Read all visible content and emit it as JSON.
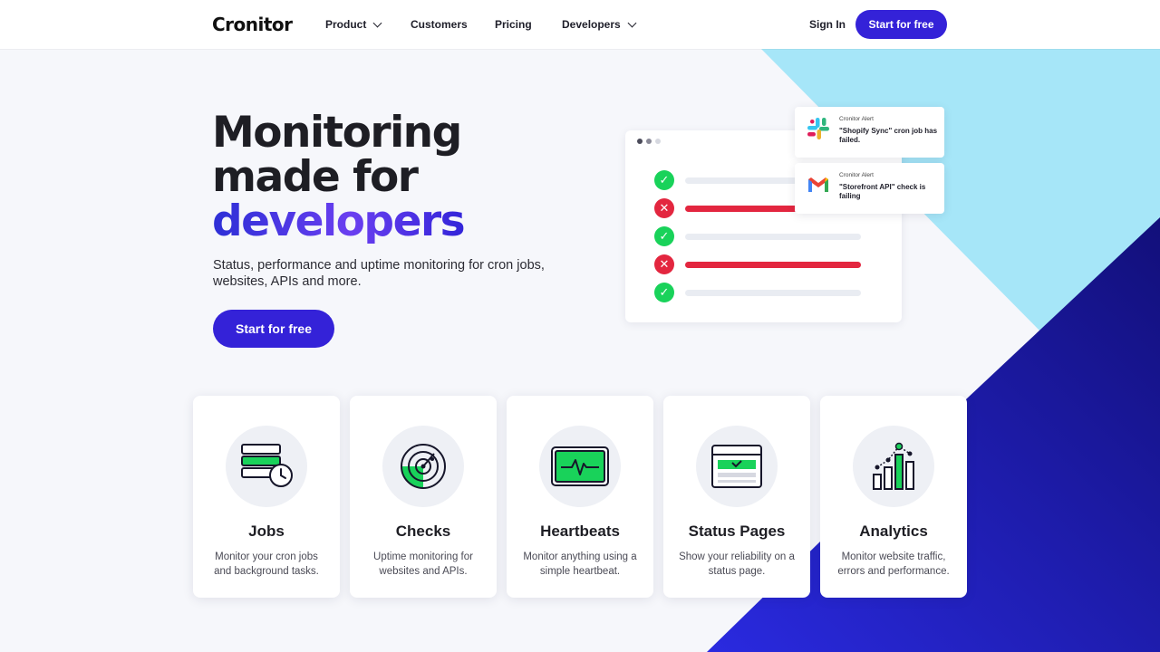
{
  "colors": {
    "brand": "#3422d8",
    "ok": "#19d25a",
    "fail": "#e3263f",
    "light_blue": "#a6e6f8",
    "dark_blue": "#1b1ca6"
  },
  "nav": {
    "logo": "Cronitor",
    "items": [
      {
        "label": "Product",
        "has_dropdown": true
      },
      {
        "label": "Customers",
        "has_dropdown": false
      },
      {
        "label": "Pricing",
        "has_dropdown": false
      },
      {
        "label": "Developers",
        "has_dropdown": true
      }
    ],
    "sign_in": "Sign In",
    "cta": "Start for free"
  },
  "hero": {
    "title_line1": "Monitoring",
    "title_line2": "made for",
    "title_accent": "developers",
    "subtitle": "Status, performance and uptime monitoring for cron jobs, websites, APIs and more.",
    "cta": "Start for free"
  },
  "illustration": {
    "rows": [
      {
        "status": "ok"
      },
      {
        "status": "fail"
      },
      {
        "status": "ok"
      },
      {
        "status": "fail"
      },
      {
        "status": "ok"
      }
    ],
    "alerts": [
      {
        "app_icon": "slack-icon",
        "title": "Cronitor Alert",
        "message": "\"Shopify Sync\" cron job has failed."
      },
      {
        "app_icon": "gmail-icon",
        "title": "Cronitor Alert",
        "message": "\"Storefront API\" check  is failing"
      }
    ]
  },
  "features": [
    {
      "icon": "jobs-icon",
      "title": "Jobs",
      "desc": "Monitor your cron jobs and background tasks."
    },
    {
      "icon": "radar-icon",
      "title": "Checks",
      "desc": "Uptime monitoring for websites and APIs."
    },
    {
      "icon": "heartbeat-icon",
      "title": "Heartbeats",
      "desc": "Monitor anything using a simple heartbeat."
    },
    {
      "icon": "status-page-icon",
      "title": "Status Pages",
      "desc": "Show your reliability on a status page."
    },
    {
      "icon": "analytics-icon",
      "title": "Analytics",
      "desc": "Monitor website traffic, errors and performance."
    }
  ]
}
